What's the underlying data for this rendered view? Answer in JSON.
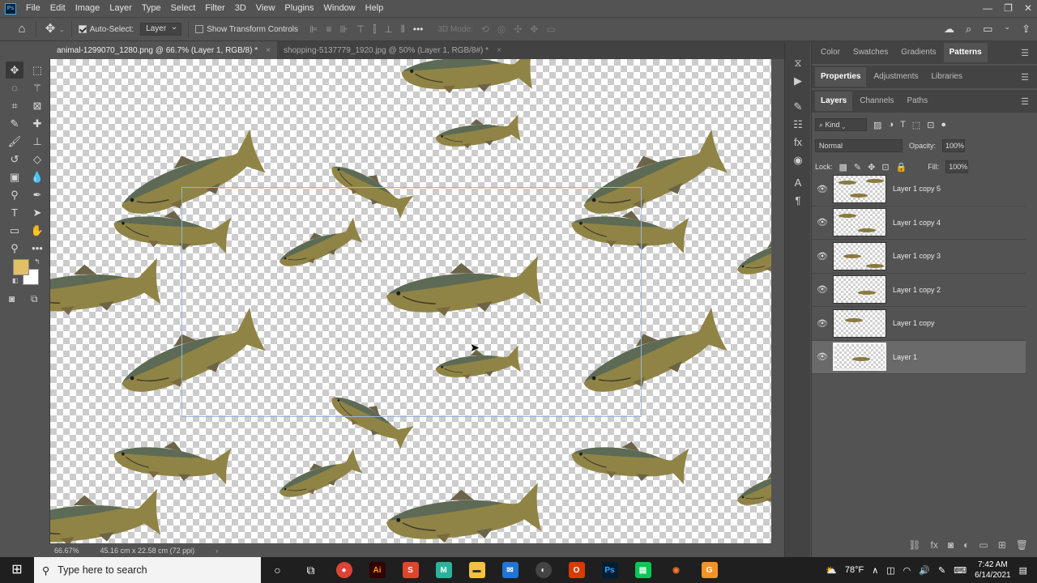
{
  "menu": [
    "File",
    "Edit",
    "Image",
    "Layer",
    "Type",
    "Select",
    "Filter",
    "3D",
    "View",
    "Plugins",
    "Window",
    "Help"
  ],
  "options_bar": {
    "auto_select_label": "Auto-Select:",
    "auto_select_value": "Layer",
    "show_transform_label": "Show Transform Controls",
    "mode_3d_label": "3D Mode:"
  },
  "doc_tabs": [
    {
      "label": "animal-1299070_1280.png @ 66.7% (Layer 1, RGB/8) *",
      "active": true
    },
    {
      "label": "shopping-5137779_1920.jpg @ 50% (Layer 1, RGB/8#) *",
      "active": false
    }
  ],
  "status": {
    "zoom": "66.67%",
    "doc_info": "45.16 cm x 22.58 cm (72 ppi)"
  },
  "panel_groups": {
    "top_tabs": [
      "Color",
      "Swatches",
      "Gradients",
      "Patterns"
    ],
    "top_active": "Patterns",
    "mid_tabs": [
      "Properties",
      "Adjustments",
      "Libraries"
    ],
    "mid_active": "Properties",
    "layer_tabs": [
      "Layers",
      "Channels",
      "Paths"
    ],
    "layer_active": "Layers"
  },
  "layers_panel": {
    "kind_label": "Kind",
    "blend_mode": "Normal",
    "opacity_label": "Opacity:",
    "opacity_value": "100%",
    "lock_label": "Lock:",
    "fill_label": "Fill:",
    "fill_value": "100%",
    "layers": [
      {
        "name": "Layer 1 copy 5",
        "selected": false
      },
      {
        "name": "Layer 1 copy 4",
        "selected": false
      },
      {
        "name": "Layer 1 copy 3",
        "selected": false
      },
      {
        "name": "Layer 1 copy 2",
        "selected": false
      },
      {
        "name": "Layer 1 copy",
        "selected": false
      },
      {
        "name": "Layer 1",
        "selected": true
      }
    ]
  },
  "taskbar": {
    "search_placeholder": "Type here to search",
    "weather": "78°F",
    "time": "7:42 AM",
    "date": "6/14/2021"
  },
  "colors": {
    "foreground": "#e2c066",
    "background": "#ffffff",
    "fish_body": "#8f8446",
    "fish_back": "#5d6a55",
    "fish_fin": "#6b6448"
  }
}
